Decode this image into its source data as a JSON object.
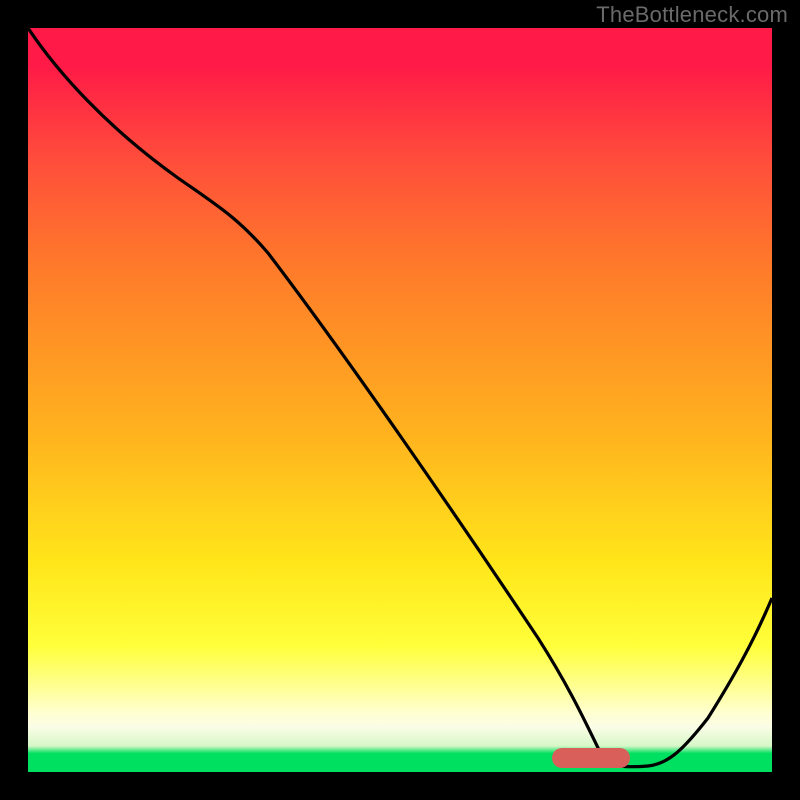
{
  "watermark": "TheBottleneck.com",
  "colors": {
    "background": "#000000",
    "curve": "#000000",
    "marker": "#d9605a",
    "gradient_top": "#ff1a47",
    "gradient_mid1": "#ffb41e",
    "gradient_mid2": "#ffff3a",
    "gradient_bottom": "#00e060"
  },
  "chart_data": {
    "type": "line",
    "title": "",
    "xlabel": "",
    "ylabel": "",
    "xlim": [
      0,
      100
    ],
    "ylim": [
      0,
      100
    ],
    "series": [
      {
        "name": "curve",
        "x": [
          0,
          6,
          17,
          24,
          33,
          48,
          62,
          72,
          76,
          80,
          84,
          88,
          94,
          100
        ],
        "values": [
          100,
          94,
          84,
          76,
          64,
          44,
          25,
          11,
          5,
          1,
          1,
          5,
          14,
          25
        ]
      }
    ],
    "marker": {
      "x_start": 76,
      "x_end": 86,
      "y": 1
    }
  }
}
